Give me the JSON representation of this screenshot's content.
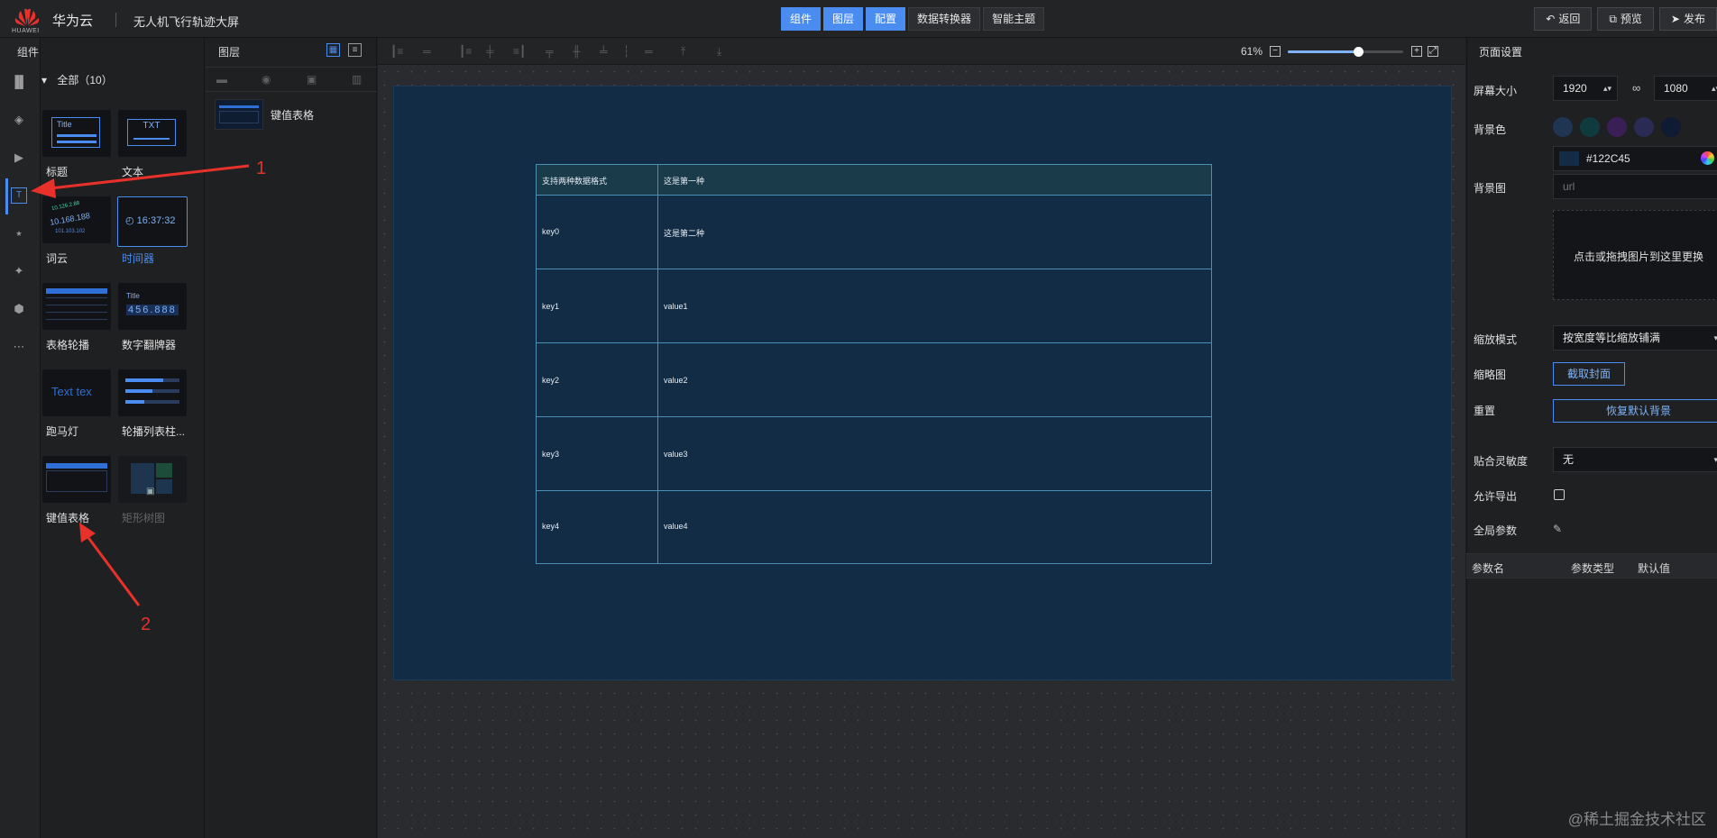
{
  "topbar": {
    "logo_text": "HUAWEI",
    "brand": "华为云",
    "project": "无人机飞行轨迹大屏",
    "center_buttons": [
      {
        "label": "组件",
        "active": true
      },
      {
        "label": "图层",
        "active": true
      },
      {
        "label": "配置",
        "active": true
      },
      {
        "label": "数据转换器",
        "active": false
      },
      {
        "label": "智能主题",
        "active": false
      }
    ],
    "right_buttons": {
      "back": "返回",
      "preview": "预览",
      "publish": "发布"
    }
  },
  "rail": {
    "title": "组件",
    "icons": [
      "bar-chart-icon",
      "map-icon",
      "media-icon",
      "text-icon",
      "relation-icon",
      "interaction-icon",
      "other-icon",
      "more-icon"
    ]
  },
  "components": {
    "group_label": "全部（10）",
    "items": [
      {
        "label": "标题",
        "thumb_text": "Title"
      },
      {
        "label": "文本",
        "thumb_text": "TXT"
      },
      {
        "label": "词云",
        "thumb_text": "10.168.188"
      },
      {
        "label": "时间器",
        "thumb_text": "16:37:32",
        "selected": true
      },
      {
        "label": "表格轮播",
        "thumb_text": ""
      },
      {
        "label": "数字翻牌器",
        "thumb_text": "456.888",
        "thumb_title": "Title"
      },
      {
        "label": "跑马灯",
        "thumb_text": "Text tex"
      },
      {
        "label": "轮播列表柱...",
        "thumb_text": ""
      },
      {
        "label": "键值表格",
        "thumb_text": ""
      },
      {
        "label": "矩形树图",
        "thumb_text": "",
        "disabled": true
      }
    ]
  },
  "layers": {
    "title": "图层",
    "items": [
      {
        "label": "键值表格"
      }
    ]
  },
  "canvas": {
    "zoom_label": "61%",
    "zoom_level": 0.61,
    "table": {
      "header": {
        "key": "支持两种数据格式",
        "value": "这是第一种"
      },
      "rows": [
        {
          "key": "key0",
          "value": "这是第二种"
        },
        {
          "key": "key1",
          "value": "value1"
        },
        {
          "key": "key2",
          "value": "value2"
        },
        {
          "key": "key3",
          "value": "value3"
        },
        {
          "key": "key4",
          "value": "value4"
        }
      ]
    },
    "screen_color": "#122c45"
  },
  "settings": {
    "title": "页面设置",
    "screen_size_label": "屏幕大小",
    "width": "1920",
    "height": "1080",
    "bg_color_label": "背景色",
    "swatches": [
      "#1f3552",
      "#0f3a3e",
      "#3a1f56",
      "#2a2b55",
      "#0f1a33"
    ],
    "bg_color_value": "#122C45",
    "bg_image_label": "背景图",
    "bg_image_placeholder": "url",
    "upload_text": "点击或拖拽图片到这里更换",
    "scale_mode_label": "缩放模式",
    "scale_mode_value": "按宽度等比缩放铺满",
    "thumbnail_label": "缩略图",
    "thumbnail_button": "截取封面",
    "reset_label": "重置",
    "reset_button": "恢复默认背景",
    "snap_label": "贴合灵敏度",
    "snap_value": "无",
    "allow_export_label": "允许导出",
    "global_params_label": "全局参数",
    "param_columns": [
      "参数名",
      "参数类型",
      "默认值"
    ]
  },
  "annotations": {
    "one": "1",
    "two": "2"
  },
  "watermark": "@稀土掘金技术社区",
  "colors": {
    "accent": "#4a8cf0",
    "annotation": "#e8312a"
  }
}
